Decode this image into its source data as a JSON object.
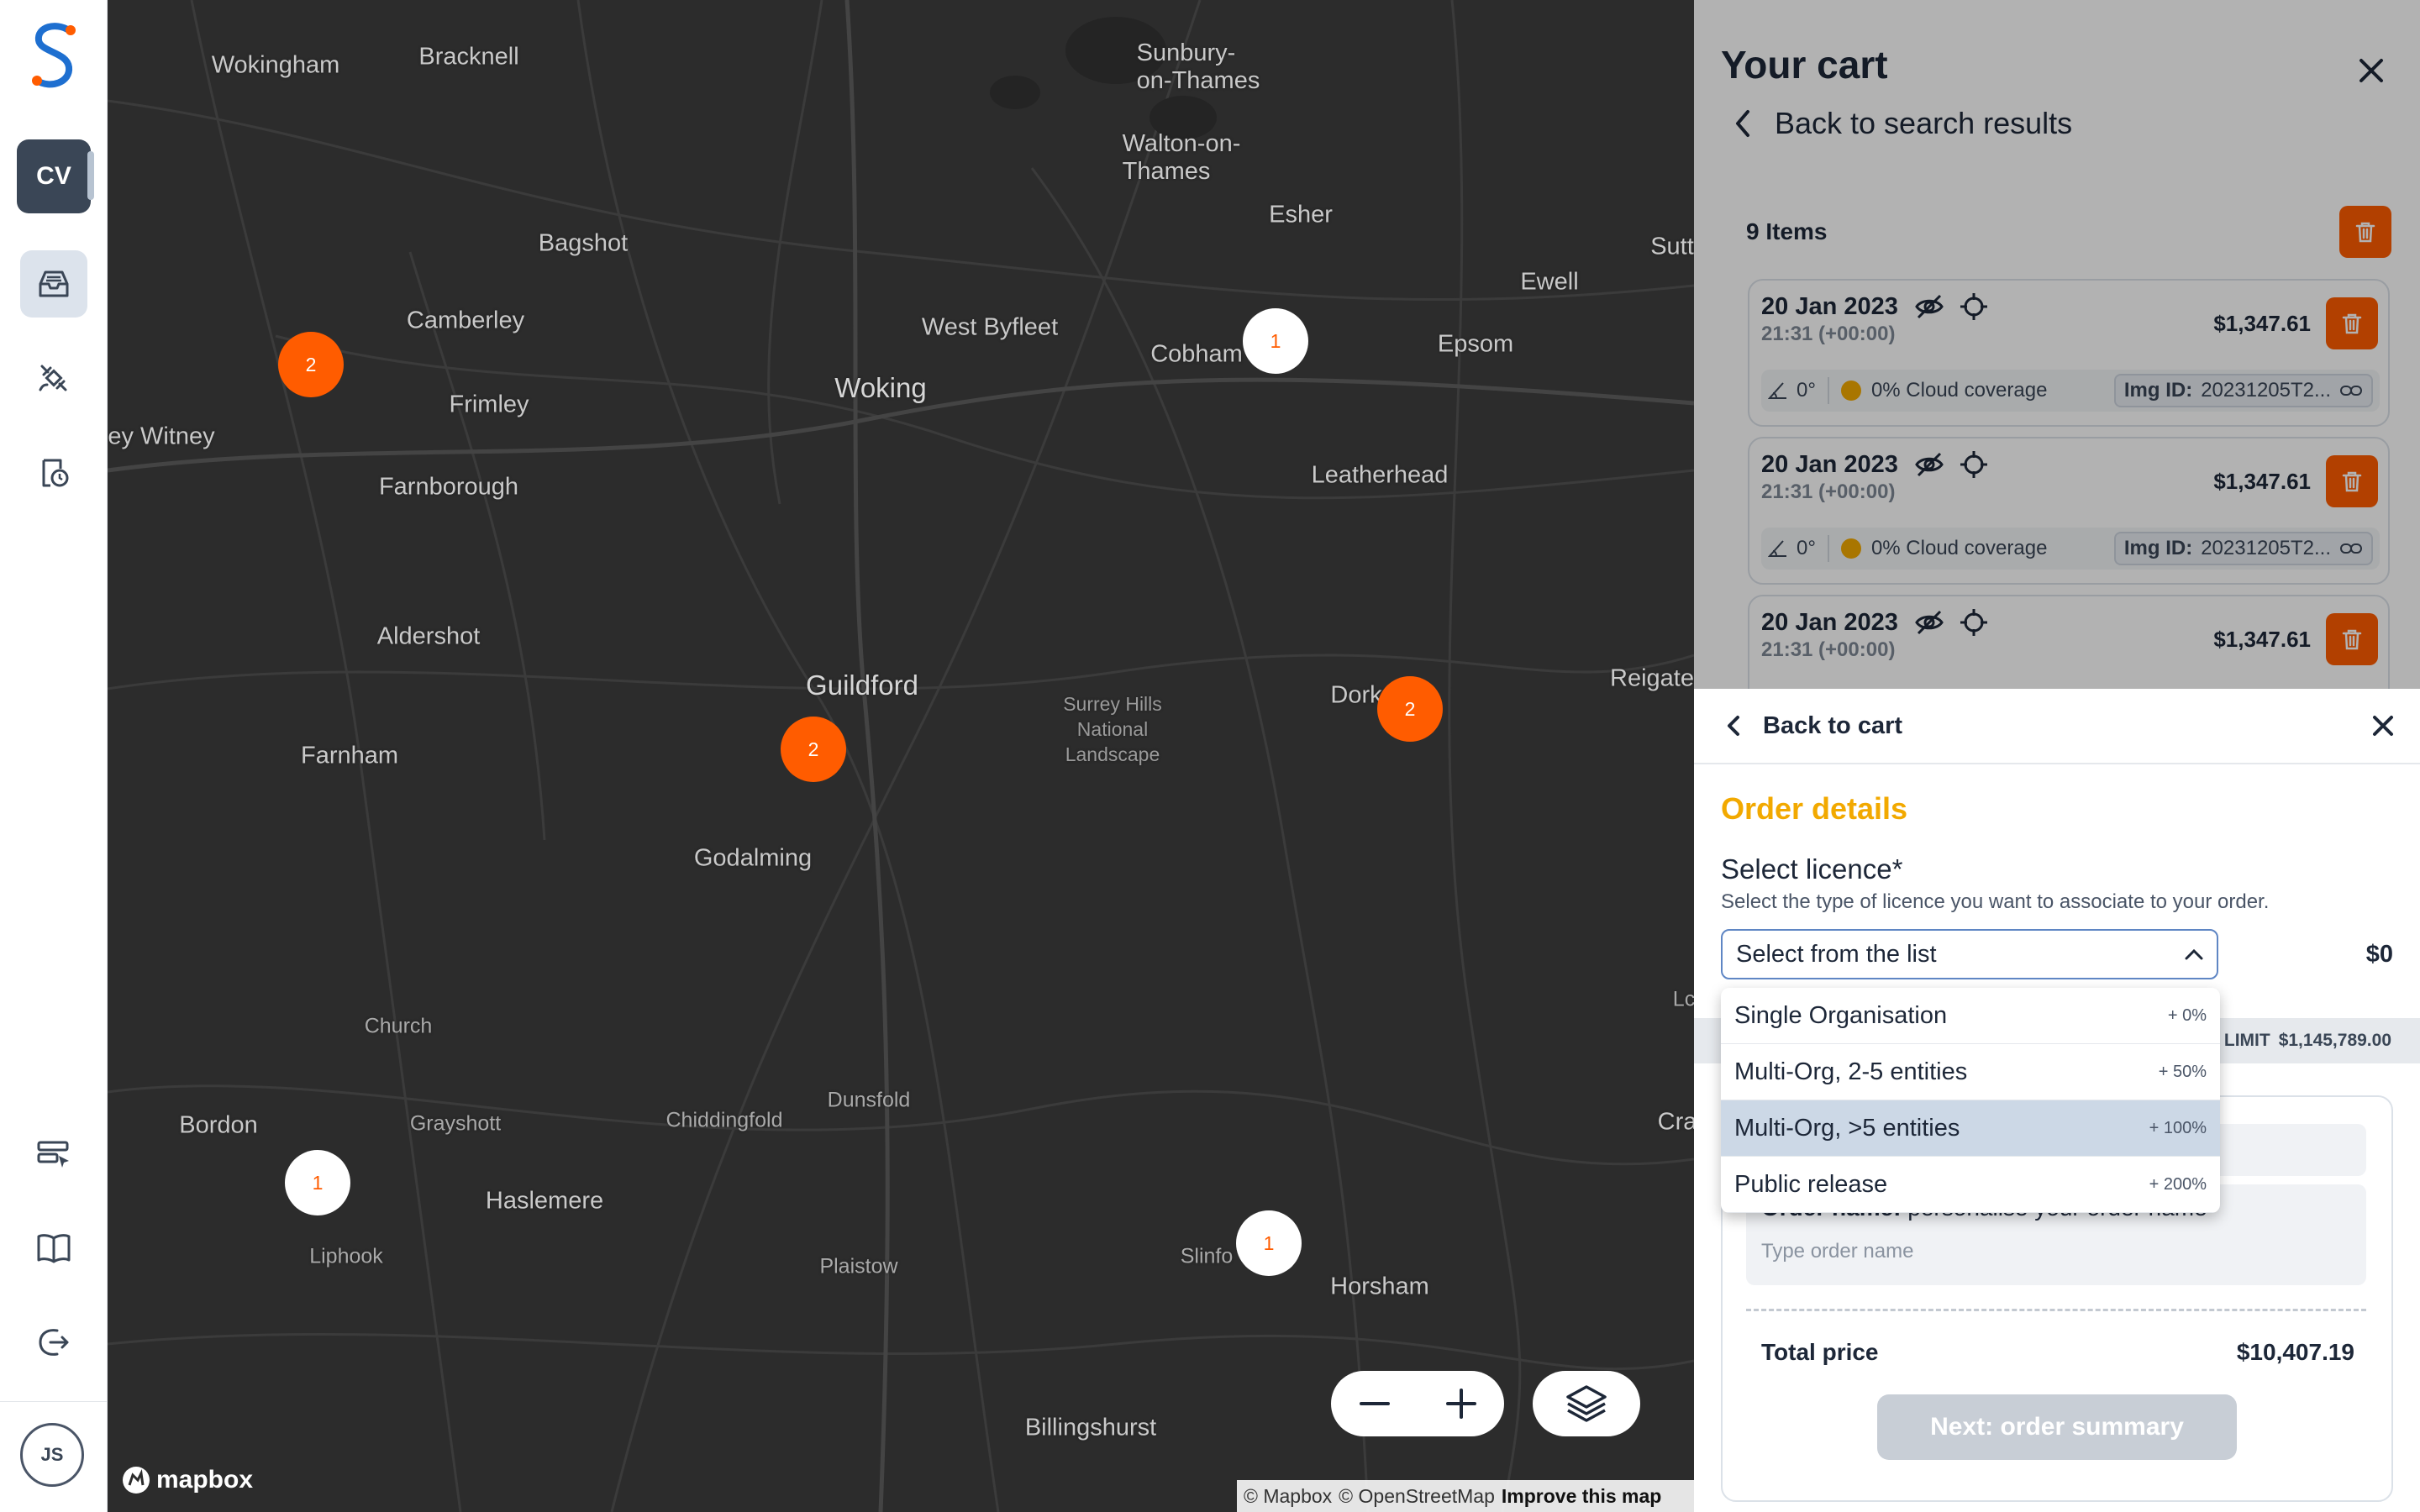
{
  "sidebar": {
    "workspace_initials": "CV",
    "user_initials": "JS"
  },
  "map": {
    "places": [
      {
        "name": "Wokingham",
        "size": "med"
      },
      {
        "name": "Bracknell",
        "size": "med"
      },
      {
        "name": "Sunbury-on-Thames",
        "size": "med"
      },
      {
        "name": "Walton-on-Thames",
        "size": "med"
      },
      {
        "name": "Esher",
        "size": "med"
      },
      {
        "name": "Bagshot",
        "size": "med"
      },
      {
        "name": "Sutt",
        "size": "med"
      },
      {
        "name": "Ewell",
        "size": "med"
      },
      {
        "name": "Camberley",
        "size": "med"
      },
      {
        "name": "West Byfleet",
        "size": "med"
      },
      {
        "name": "Cobham",
        "size": "med"
      },
      {
        "name": "Epsom",
        "size": "med"
      },
      {
        "name": "Woking",
        "size": "big"
      },
      {
        "name": "Frimley",
        "size": "med"
      },
      {
        "name": "ey Witney",
        "size": "med"
      },
      {
        "name": "Farnborough",
        "size": "med"
      },
      {
        "name": "Leatherhead",
        "size": "med"
      },
      {
        "name": "Aldershot",
        "size": "med"
      },
      {
        "name": "Guildford",
        "size": "big"
      },
      {
        "name": "Reigate",
        "size": "med"
      },
      {
        "name": "Dork",
        "size": "med"
      },
      {
        "name": "Farnham",
        "size": "med"
      },
      {
        "name": "Godalming",
        "size": "med"
      },
      {
        "name": "Church",
        "size": "sm"
      },
      {
        "name": "Bordon",
        "size": "med"
      },
      {
        "name": "Grayshott",
        "size": "sm"
      },
      {
        "name": "Chiddingfold",
        "size": "sm"
      },
      {
        "name": "Dunsfold",
        "size": "sm"
      },
      {
        "name": "Haslemere",
        "size": "med"
      },
      {
        "name": "Liphook",
        "size": "sm"
      },
      {
        "name": "Plaistow",
        "size": "sm"
      },
      {
        "name": "Slinfo",
        "size": "sm"
      },
      {
        "name": "Horsham",
        "size": "med"
      },
      {
        "name": "Billingshurst",
        "size": "med"
      },
      {
        "name": "Cra",
        "size": "med"
      },
      {
        "name": "Lc",
        "size": "sm"
      }
    ],
    "park_label": "Surrey Hills National Landscape",
    "clusters": [
      {
        "count": "2",
        "style": "orange"
      },
      {
        "count": "1",
        "style": "white"
      },
      {
        "count": "2",
        "style": "orange"
      },
      {
        "count": "2",
        "style": "orange"
      },
      {
        "count": "1",
        "style": "white"
      },
      {
        "count": "1",
        "style": "white"
      }
    ],
    "mapbox_label": "mapbox",
    "attribution": {
      "mapbox": "© Mapbox",
      "osm": "© OpenStreetMap",
      "improve": "Improve this map"
    }
  },
  "cart": {
    "title": "Your cart",
    "back_label": "Back to search results",
    "items_count": "9 Items",
    "items": [
      {
        "date": "20 Jan 2023",
        "time": "21:31 (+00:00)",
        "price": "$1,347.61",
        "angle": "0°",
        "cloud": "0% Cloud coverage",
        "img_label": "Img ID:",
        "img_id": "20231205T2..."
      },
      {
        "date": "20 Jan 2023",
        "time": "21:31 (+00:00)",
        "price": "$1,347.61",
        "angle": "0°",
        "cloud": "0% Cloud coverage",
        "img_label": "Img ID:",
        "img_id": "20231205T2..."
      },
      {
        "date": "20 Jan 2023",
        "time": "21:31 (+00:00)",
        "price": "$1,347.61"
      }
    ]
  },
  "order": {
    "back_label": "Back to cart",
    "heading": "Order details",
    "licence_label": "Select licence*",
    "licence_hint": "Select the type of licence you want to associate to your order.",
    "select_placeholder": "Select from the list",
    "licence_price": "$0",
    "credit_limit_label": "T LIMIT",
    "credit_limit_value": "$1,145,789.00",
    "options": [
      {
        "label": "Single Organisation",
        "pct": "+ 0%"
      },
      {
        "label": "Multi-Org, 2-5 entities",
        "pct": "+ 50%"
      },
      {
        "label": "Multi-Org, >5 entities",
        "pct": "+ 100%",
        "highlighted": true
      },
      {
        "label": "Public release",
        "pct": "+ 200%"
      }
    ],
    "name_label_bold": "Order name:",
    "name_label_rest": "personalise your order name",
    "name_placeholder": "Type order name",
    "total_label": "Total price",
    "total_value": "$10,407.19",
    "next_label": "Next: order summary"
  },
  "colors": {
    "accent": "#ff5c00",
    "heading_gold": "#f2a900",
    "navy": "#1d2738",
    "map_bg": "#2c2c2c"
  }
}
